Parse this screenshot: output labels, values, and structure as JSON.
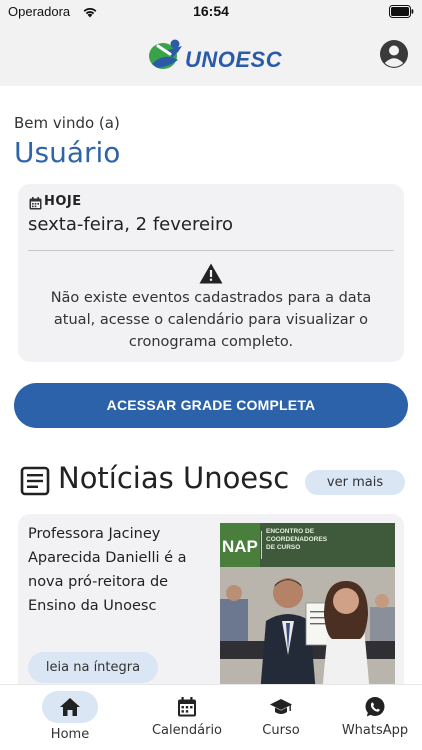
{
  "status_bar": {
    "carrier": "Operadora",
    "time": "16:54"
  },
  "header": {
    "logo_text": "UNOESC"
  },
  "greeting": {
    "welcome": "Bem vindo (a)",
    "user": "Usuário"
  },
  "today": {
    "label": "HOJE",
    "date": "sexta-feira, 2 fevereiro",
    "message": "Não existe eventos cadastrados para a data atual, acesse o calendário para visualizar o cronograma completo."
  },
  "grade_button": "ACESSAR GRADE COMPLETA",
  "news": {
    "title": "Notícias Unoesc",
    "see_more": "ver mais",
    "items": [
      {
        "headline": "Professora Jaciney Aparecida Danielli é a nova pró-reitora de Ensino da Unoesc",
        "read_more": "leia na íntegra",
        "photo_banner_left": "NAP",
        "photo_banner_right": "ENCONTRO DE COORDENADORES DE CURSO"
      }
    ]
  },
  "bottom_nav": [
    {
      "label": "Home",
      "icon": "home-icon",
      "active": true
    },
    {
      "label": "Calendário",
      "icon": "calendar-icon",
      "active": false
    },
    {
      "label": "Curso",
      "icon": "graduation-cap-icon",
      "active": false
    },
    {
      "label": "WhatsApp",
      "icon": "whatsapp-icon",
      "active": false
    }
  ],
  "colors": {
    "brand_blue": "#2c62a9",
    "pill_blue": "#dbe6f4",
    "logo_green": "#3aa34a"
  }
}
